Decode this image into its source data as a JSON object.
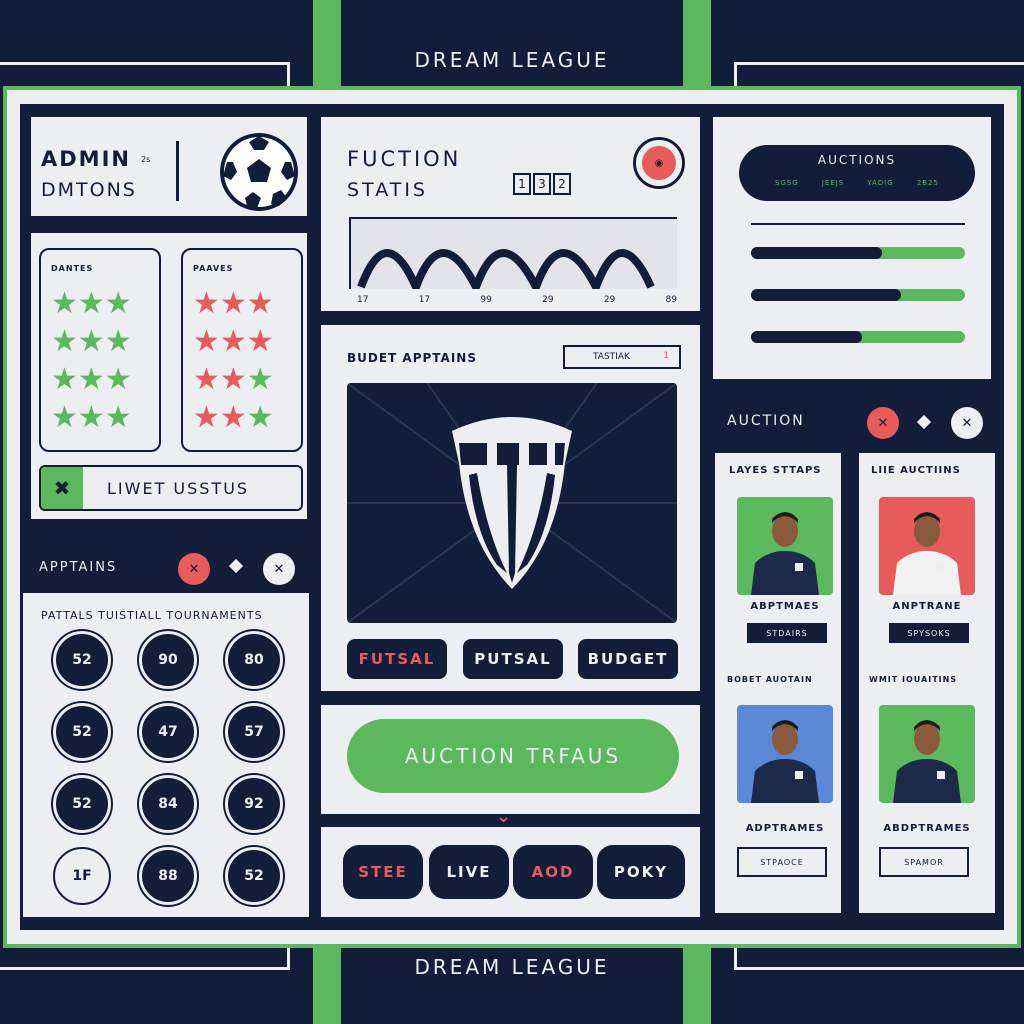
{
  "header_title": "DREAM LEAGUE",
  "footer_title": "DREAM LEAGUE",
  "admin": {
    "line1": "ADMIN",
    "sup": "2s",
    "line2": "DMTONS"
  },
  "rating": {
    "left_title": "DANTES",
    "right_title": "PAAVES",
    "status_label": "LIWET USSTUS"
  },
  "apptains": {
    "title": "APPTAINS",
    "subtitle": "PATTALS TUISTIALL TOURNAMENTS",
    "circles": [
      "52",
      "90",
      "80",
      "52",
      "47",
      "57",
      "52",
      "84",
      "92",
      "1F",
      "88",
      "52"
    ]
  },
  "stats": {
    "title1": "FUCTION",
    "title2": "STATIS",
    "counter": [
      "1",
      "3",
      "2"
    ],
    "ticks": [
      "17",
      "17",
      "99",
      "29",
      "29",
      "89"
    ]
  },
  "budget": {
    "title": "BUDET APPTAINS",
    "tag": "TASTIAK",
    "tag_mark": "1",
    "buttons": [
      "FUTSAL",
      "PUTSAL",
      "BUDGET"
    ]
  },
  "auction_cta": "AUCTION TRFAUS",
  "bottom_buttons": [
    "STEE",
    "LIVE",
    "AOD",
    "POKY"
  ],
  "auction_top": {
    "title": "AUCTIONS",
    "items": [
      "SGSG",
      "JEEJS",
      "YADIG",
      "2B25"
    ]
  },
  "auction_bars": [
    0.61,
    0.7,
    0.52
  ],
  "auction": {
    "title": "AUCTION",
    "col1_title": "LAYES STTAPS",
    "col2_title": "LIIE AUCTIINS",
    "cards": [
      {
        "name": "ABPTMAES",
        "btn": "STDAIRS",
        "bg": "#5cb85c",
        "shirt": "#1e2a4a"
      },
      {
        "name": "ANPTRANE",
        "btn": "SPYSOKS",
        "bg": "#e85b5b",
        "shirt": "#f2f2f2"
      },
      {
        "name": "ADPTRAMES",
        "btn": "STPAOCE",
        "bg": "#5a87d6",
        "shirt": "#1e2a4a"
      },
      {
        "name": "ABDPTRAMES",
        "btn": "SPAMOR",
        "bg": "#5cb85c",
        "shirt": "#1e2a4a"
      }
    ],
    "mid_left": "BOBET AUOTAIN",
    "mid_right": "WMIT IOUAITINS"
  },
  "colors": {
    "navy": "#121d3a",
    "green": "#5cb85c",
    "red": "#e85b5b",
    "panel": "#eceef2"
  }
}
